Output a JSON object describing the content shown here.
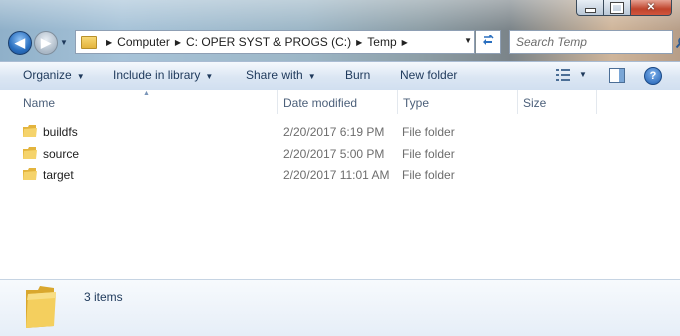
{
  "window": {
    "minimize": "–",
    "maximize": "□",
    "close": "✕"
  },
  "address": {
    "crumbs": [
      "Computer",
      "C: OPER SYST & PROGS (C:)",
      "Temp"
    ]
  },
  "search": {
    "placeholder": "Search Temp"
  },
  "toolbar": {
    "organize": "Organize",
    "include": "Include in library",
    "share": "Share with",
    "burn": "Burn",
    "new_folder": "New folder"
  },
  "columns": {
    "name": "Name",
    "date": "Date modified",
    "type": "Type",
    "size": "Size"
  },
  "files": [
    {
      "name": "buildfs",
      "date": "2/20/2017 6:19 PM",
      "type": "File folder"
    },
    {
      "name": "source",
      "date": "2/20/2017 5:00 PM",
      "type": "File folder"
    },
    {
      "name": "target",
      "date": "2/20/2017 11:01 AM",
      "type": "File folder"
    }
  ],
  "details": {
    "count": "3 items"
  },
  "icons": {
    "back": "back-arrow-icon",
    "forward": "forward-arrow-icon",
    "refresh": "refresh-icon",
    "search": "search-icon",
    "views": "views-icon",
    "preview_pane": "preview-pane-icon",
    "help": "help-icon",
    "folder": "folder-icon"
  },
  "colors": {
    "folder": "#e8b947",
    "accent": "#1e395b",
    "close": "#c0442c"
  }
}
